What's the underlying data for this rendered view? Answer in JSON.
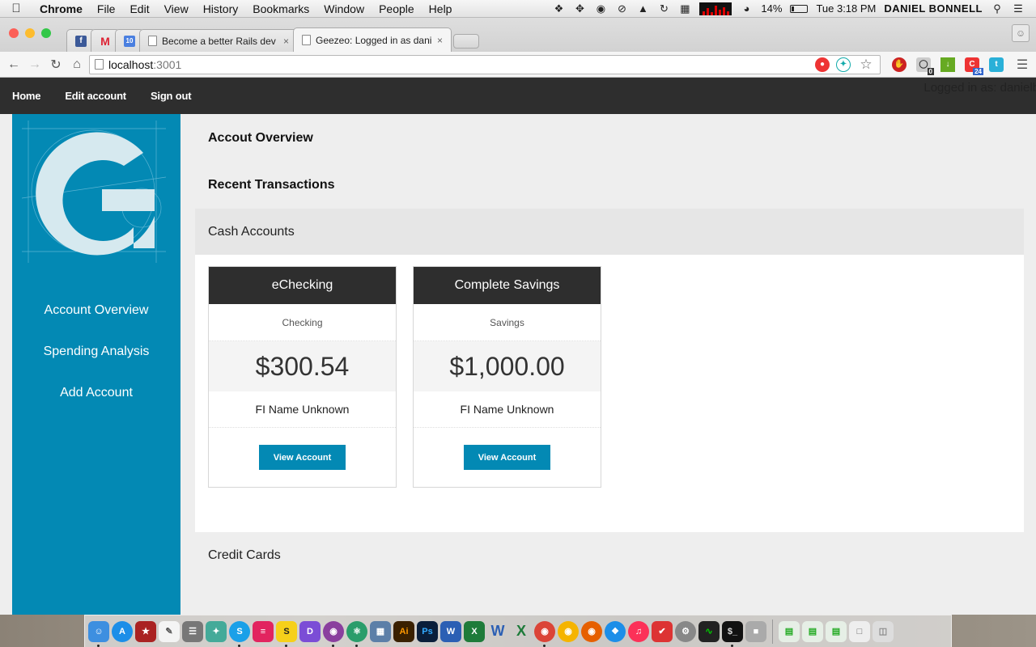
{
  "menubar": {
    "app": "Chrome",
    "items": [
      "File",
      "Edit",
      "View",
      "History",
      "Bookmarks",
      "Window",
      "People",
      "Help"
    ],
    "battery": "14%",
    "clock": "Tue 3:18 PM",
    "user": "DANIEL BONNELL"
  },
  "browser": {
    "tabs": [
      {
        "title": "Become a better Rails dev",
        "close": "×"
      },
      {
        "title": "Geezeo: Logged in as dani",
        "close": "×"
      }
    ],
    "pinned_calendar_label": "10",
    "url_host": "localhost",
    "url_port": ":3001",
    "extension_badges": {
      "ghostery": "0",
      "calendar": "24"
    }
  },
  "navbar": {
    "links": [
      "Home",
      "Edit account",
      "Sign out"
    ],
    "logged_in": "Logged in as: danielb"
  },
  "sidebar": {
    "logo_mark": "®",
    "items": [
      "Account Overview",
      "Spending Analysis",
      "Add Account"
    ]
  },
  "main": {
    "overview_heading": "Accout Overview",
    "transactions_heading": "Recent Transactions",
    "cash_accounts_title": "Cash Accounts",
    "accounts": [
      {
        "name": "eChecking",
        "type": "Checking",
        "balance": "$300.54",
        "institution": "FI Name Unknown",
        "button": "View Account"
      },
      {
        "name": "Complete Savings",
        "type": "Savings",
        "balance": "$1,000.00",
        "institution": "FI Name Unknown",
        "button": "View Account"
      }
    ],
    "credit_cards_title": "Credit Cards"
  },
  "colors": {
    "brand_blue": "#0389b4",
    "navbar_dark": "#2e2e2e",
    "card_header": "#2e2e2e"
  }
}
